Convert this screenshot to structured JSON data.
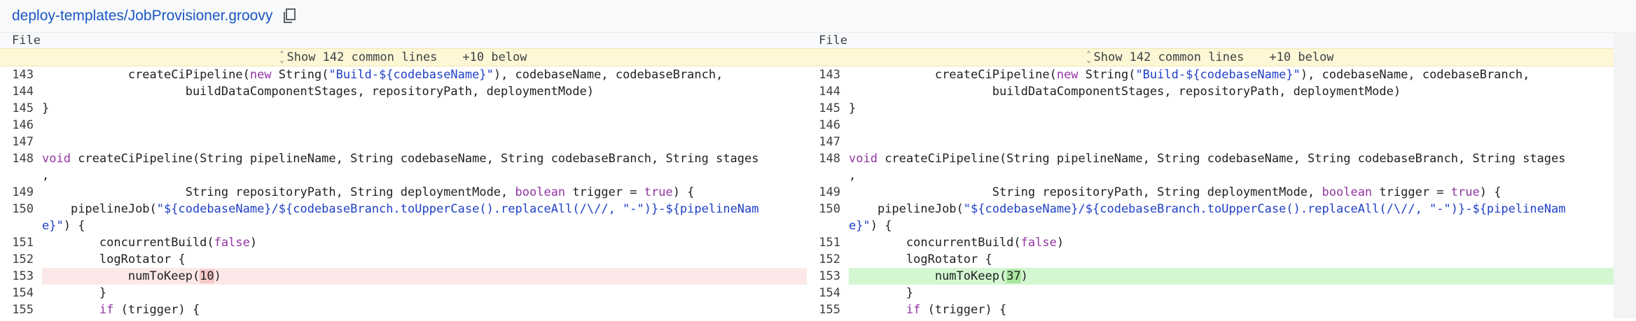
{
  "header": {
    "file_path": "deploy-templates/JobProvisioner.groovy",
    "copy_icon": "copy-icon"
  },
  "left": {
    "file_label": "File",
    "skip": {
      "text": "Show 142 common lines",
      "below": "+10 below"
    }
  },
  "right": {
    "file_label": "File",
    "skip": {
      "text": "Show 142 common lines",
      "below": "+10 below"
    }
  },
  "lines": [
    {
      "n": "143",
      "parts": [
        [
          "p",
          "            createCiPipeline("
        ],
        [
          "k",
          "new"
        ],
        [
          "p",
          " String("
        ],
        [
          "s",
          "\"Build-${codebaseName}\""
        ],
        [
          "p",
          "), codebaseName, codebaseBranch,"
        ]
      ]
    },
    {
      "n": "144",
      "parts": [
        [
          "p",
          "                    buildDataComponentStages, repositoryPath, deploymentMode)"
        ]
      ]
    },
    {
      "n": "145",
      "parts": [
        [
          "p",
          "}"
        ]
      ]
    },
    {
      "n": "146",
      "parts": [
        [
          "p",
          ""
        ]
      ]
    },
    {
      "n": "147",
      "parts": [
        [
          "p",
          ""
        ]
      ]
    },
    {
      "n": "148",
      "parts": [
        [
          "k",
          "void"
        ],
        [
          "p",
          " createCiPipeline(String pipelineName, String codebaseName, String codebaseBranch, String stages\n,"
        ]
      ]
    },
    {
      "n": "149",
      "parts": [
        [
          "p",
          "                    String repositoryPath, String deploymentMode, "
        ],
        [
          "k",
          "boolean"
        ],
        [
          "p",
          " trigger = "
        ],
        [
          "k",
          "true"
        ],
        [
          "p",
          ") {"
        ]
      ]
    },
    {
      "n": "150",
      "parts": [
        [
          "p",
          "    pipelineJob("
        ],
        [
          "s",
          "\"${codebaseName}/${codebaseBranch.toUpperCase().replaceAll(/\\//, \"-\")}-${pipelineNam\ne}\""
        ],
        [
          "p",
          ") {"
        ]
      ]
    },
    {
      "n": "151",
      "parts": [
        [
          "p",
          "        concurrentBuild("
        ],
        [
          "k",
          "false"
        ],
        [
          "p",
          ")"
        ]
      ]
    },
    {
      "n": "152",
      "parts": [
        [
          "p",
          "        logRotator {"
        ]
      ]
    },
    {
      "n": "153",
      "diff": true,
      "left": [
        [
          "p",
          "            numToKeep("
        ],
        [
          "hd",
          "10"
        ],
        [
          "p",
          ")"
        ]
      ],
      "right": [
        [
          "p",
          "            numToKeep("
        ],
        [
          "ha",
          "37"
        ],
        [
          "p",
          ")"
        ]
      ]
    },
    {
      "n": "154",
      "parts": [
        [
          "p",
          "        }"
        ]
      ]
    },
    {
      "n": "155",
      "parts": [
        [
          "p",
          "        "
        ],
        [
          "k",
          "if"
        ],
        [
          "p",
          " (trigger) {"
        ]
      ]
    }
  ]
}
